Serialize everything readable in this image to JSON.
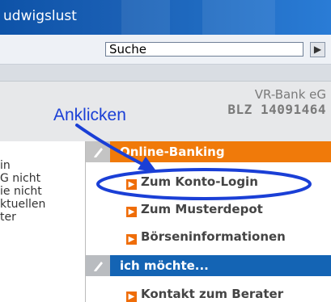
{
  "header": {
    "title": "udwigslust"
  },
  "search": {
    "placeholder": "Suche",
    "button_icon": "arrow-right-icon"
  },
  "bank": {
    "name": "VR-Bank eG",
    "blz": "BLZ 14091464"
  },
  "annotation": {
    "callout": "Anklicken",
    "color": "#1a3fd6"
  },
  "left_snippets": [
    "in",
    "G nicht",
    "ie nicht",
    "ktuellen",
    "ter"
  ],
  "menu": {
    "online_banking": {
      "title": "Online-Banking",
      "items": [
        "Zum Konto-Login",
        "Zum Musterdepot",
        "Börseninformationen"
      ]
    },
    "ich_moechte": {
      "title": "ich möchte...",
      "items": [
        "Kontakt zum Berater"
      ]
    }
  },
  "colors": {
    "orange": "#f07a0a",
    "blue": "#1464b4",
    "topbar": "#1a5fb4"
  }
}
